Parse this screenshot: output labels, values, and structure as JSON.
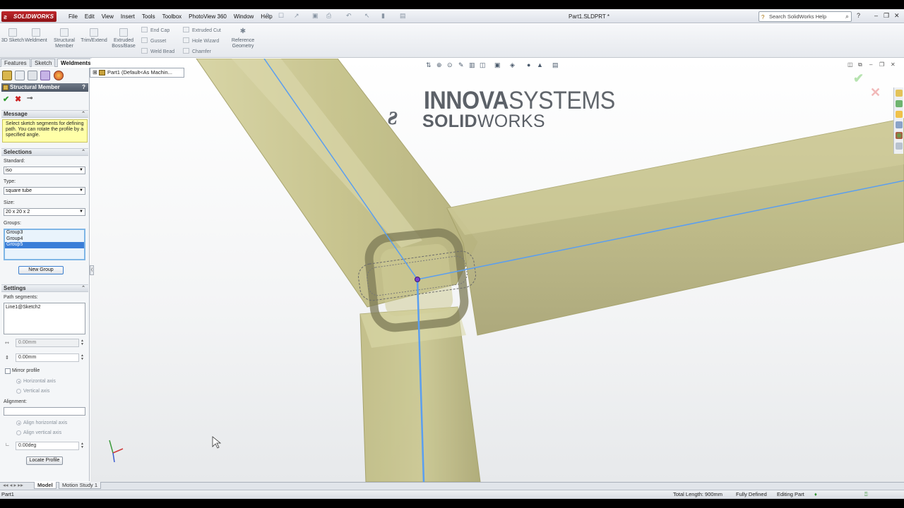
{
  "app": {
    "logo": "SOLIDWORKS",
    "doc_title": "Part1.SLDPRT *",
    "help_search_placeholder": "Search SolidWorks Help"
  },
  "menu": [
    "File",
    "Edit",
    "View",
    "Insert",
    "Tools",
    "Toolbox",
    "PhotoView 360",
    "Window",
    "Help"
  ],
  "commands": {
    "large": [
      {
        "label": "3D Sketch"
      },
      {
        "label": "Weldment"
      },
      {
        "label": "Structural Member"
      },
      {
        "label": "Trim/Extend"
      },
      {
        "label": "Extruded Boss/Base"
      }
    ],
    "small": [
      {
        "label": "End Cap"
      },
      {
        "label": "Gusset"
      },
      {
        "label": "Weld Bead"
      },
      {
        "label": "Extruded Cut"
      },
      {
        "label": "Hole Wizard"
      },
      {
        "label": "Chamfer"
      },
      {
        "label": "Reference Geometry"
      }
    ]
  },
  "tabs": [
    "Features",
    "Sketch",
    "Weldments"
  ],
  "feature_tree": {
    "item": "Part1  (Default<As Machin..."
  },
  "property_manager": {
    "title": "Structural Member",
    "help": "?",
    "message": {
      "header": "Message",
      "text": "Select sketch segments for defining path. You can rotate the profile by a specified angle."
    },
    "selections": {
      "header": "Selections",
      "standard_label": "Standard:",
      "standard_value": "iso",
      "type_label": "Type:",
      "type_value": "square tube",
      "size_label": "Size:",
      "size_value": "20 x 20 x 2",
      "groups_label": "Groups:",
      "groups": [
        "Group3",
        "Group4",
        "Group5"
      ],
      "new_group": "New Group"
    },
    "settings": {
      "header": "Settings",
      "path_label": "Path segments:",
      "path_value": "Line1@Sketch2",
      "offset1": "0.00mm",
      "offset2": "0.00mm",
      "mirror_label": "Mirror profile",
      "horizontal_axis": "Horizontal axis",
      "vertical_axis": "Vertical axis",
      "alignment_label": "Alignment:",
      "align_horizontal": "Align horizontal axis",
      "align_vertical": "Align vertical axis",
      "angle": "0.00deg",
      "locate_profile": "Locate Profile"
    }
  },
  "watermark": {
    "line1_bold": "INNOVA",
    "line1_light": "SYSTEMS",
    "line2_bold": "SOLID",
    "line2_light": "WORKS"
  },
  "bottom_tabs": [
    "Model",
    "Motion Study 1"
  ],
  "status": {
    "left": "Part1",
    "total_length": "Total Length: 900mm",
    "defined": "Fully Defined",
    "mode": "Editing Part"
  },
  "colors": {
    "tube_fill": "#c9c58e",
    "tube_edge": "#a9a56a",
    "sketch_line": "#5a9ef0",
    "selection_blue": "#3a7ed8"
  }
}
